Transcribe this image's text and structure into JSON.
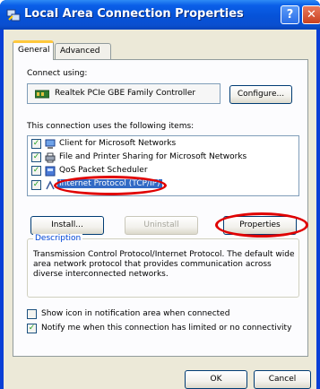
{
  "window": {
    "title": "Local Area Connection Properties",
    "help_label": "?",
    "close_label": "✕"
  },
  "tabs": [
    {
      "label": "General",
      "active": true
    },
    {
      "label": "Advanced",
      "active": false
    }
  ],
  "connect_using": {
    "label": "Connect using:",
    "adapter": "Realtek PCIe GBE Family Controller",
    "configure_label": "Configure..."
  },
  "items": {
    "label": "This connection uses the following items:",
    "list": [
      {
        "label": "Client for Microsoft Networks",
        "checked": true,
        "selected": false,
        "icon": "network-client-icon"
      },
      {
        "label": "File and Printer Sharing for Microsoft Networks",
        "checked": true,
        "selected": false,
        "icon": "printer-sharing-icon"
      },
      {
        "label": "QoS Packet Scheduler",
        "checked": true,
        "selected": false,
        "icon": "qos-scheduler-icon"
      },
      {
        "label": "Internet Protocol (TCP/IP)",
        "checked": true,
        "selected": true,
        "icon": "protocol-icon"
      }
    ]
  },
  "buttons": {
    "install": "Install...",
    "uninstall": "Uninstall",
    "properties": "Properties",
    "ok": "OK",
    "cancel": "Cancel"
  },
  "description": {
    "title": "Description",
    "text": "Transmission Control Protocol/Internet Protocol. The default wide area network protocol that provides communication across diverse interconnected networks."
  },
  "options": {
    "show_icon": {
      "label": "Show icon in notification area when connected",
      "checked": false
    },
    "notify": {
      "label": "Notify me when this connection has limited or no connectivity",
      "checked": true
    }
  },
  "colors": {
    "highlight": "#316ac5",
    "annotation_red": "#e00000",
    "title_blue": "#0652d8"
  }
}
